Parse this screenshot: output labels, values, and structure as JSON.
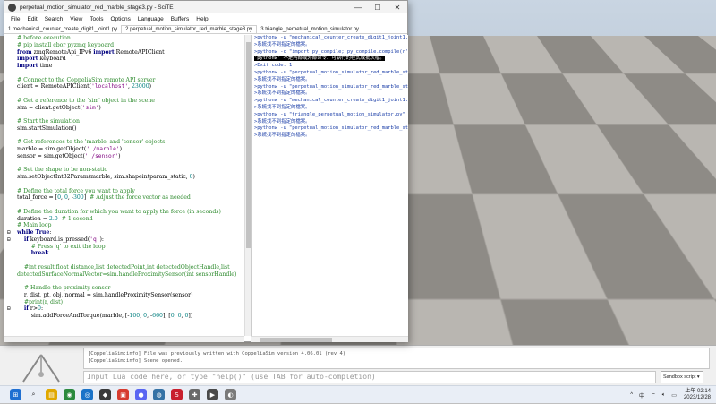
{
  "window": {
    "title": "perpetual_motion_simulator_red_marble_stage3.py - SciTE",
    "controls": {
      "minimize": "—",
      "maximize": "☐",
      "close": "✕"
    }
  },
  "menu": [
    "File",
    "Edit",
    "Search",
    "View",
    "Tools",
    "Options",
    "Language",
    "Buffers",
    "Help"
  ],
  "tabs": [
    {
      "label": "1 mechanical_counter_create_digit1_joint1.py",
      "active": false
    },
    {
      "label": "2 perpetual_motion_simulator_red_marble_stage3.py",
      "active": true
    },
    {
      "label": "3 triangle_perpetual_motion_simulator.py",
      "active": false
    }
  ],
  "code_lines": [
    {
      "text": "# before execution",
      "cls": "cm",
      "fold": ""
    },
    {
      "text": "# pip install cbor pyzmq keyboard",
      "cls": "cm",
      "fold": ""
    },
    {
      "text": "from zmqRemoteApi_IPv6 import RemoteAPIClient",
      "cls": "kwline",
      "fold": ""
    },
    {
      "text": "import keyboard",
      "cls": "kwline",
      "fold": ""
    },
    {
      "text": "import time",
      "cls": "kwline",
      "fold": ""
    },
    {
      "text": "",
      "cls": "tx",
      "fold": ""
    },
    {
      "text": "# Connect to the CoppeliaSim remote API server",
      "cls": "cm",
      "fold": ""
    },
    {
      "text": "client = RemoteAPIClient('localhost', 23000)",
      "cls": "tx",
      "fold": ""
    },
    {
      "text": "",
      "cls": "tx",
      "fold": ""
    },
    {
      "text": "# Get a reference to the 'sim' object in the scene",
      "cls": "cm",
      "fold": ""
    },
    {
      "text": "sim = client.getObject('sim')",
      "cls": "tx",
      "fold": ""
    },
    {
      "text": "",
      "cls": "tx",
      "fold": ""
    },
    {
      "text": "# Start the simulation",
      "cls": "cm",
      "fold": ""
    },
    {
      "text": "sim.startSimulation()",
      "cls": "tx",
      "fold": ""
    },
    {
      "text": "",
      "cls": "tx",
      "fold": ""
    },
    {
      "text": "# Get references to the 'marble' and 'sensor' objects",
      "cls": "cm",
      "fold": ""
    },
    {
      "text": "marble = sim.getObject('./marble')",
      "cls": "tx",
      "fold": ""
    },
    {
      "text": "sensor = sim.getObject('./sensor')",
      "cls": "tx",
      "fold": ""
    },
    {
      "text": "",
      "cls": "tx",
      "fold": ""
    },
    {
      "text": "# Set the shape to be non-static",
      "cls": "cm",
      "fold": ""
    },
    {
      "text": "sim.setObjectInt32Param(marble, sim.shapeintparam_static, 0)",
      "cls": "tx",
      "fold": ""
    },
    {
      "text": "",
      "cls": "tx",
      "fold": ""
    },
    {
      "text": "# Define the total force you want to apply",
      "cls": "cm",
      "fold": ""
    },
    {
      "text": "total_force = [0, 0, -300]  # Adjust the force vector as needed",
      "cls": "tx",
      "fold": ""
    },
    {
      "text": "",
      "cls": "tx",
      "fold": ""
    },
    {
      "text": "# Define the duration for which you want to apply the force (in seconds)",
      "cls": "cm",
      "fold": ""
    },
    {
      "text": "duration = 2.0  # 1 second",
      "cls": "tx",
      "fold": ""
    },
    {
      "text": "# Main loop",
      "cls": "cm",
      "fold": ""
    },
    {
      "text": "while True:",
      "cls": "kwline",
      "fold": "⊟"
    },
    {
      "text": "    if keyboard.is_pressed('q'):",
      "cls": "tx",
      "fold": "⊟"
    },
    {
      "text": "        # Press 'q' to exit the loop",
      "cls": "cm",
      "fold": ""
    },
    {
      "text": "        break",
      "cls": "kwline",
      "fold": ""
    },
    {
      "text": "",
      "cls": "tx",
      "fold": ""
    },
    {
      "text": "    #int result,float distance,list detectedPoint,int detectedObjectHandle,list",
      "cls": "cm",
      "fold": ""
    },
    {
      "text": "detectedSurfaceNormalVector=sim.handleProximitySensor(int sensorHandle)",
      "cls": "cm",
      "fold": ""
    },
    {
      "text": "",
      "cls": "tx",
      "fold": ""
    },
    {
      "text": "    # Handle the proximity sensor",
      "cls": "cm",
      "fold": ""
    },
    {
      "text": "    r, dist, pt, obj, normal = sim.handleProximitySensor(sensor)",
      "cls": "tx",
      "fold": ""
    },
    {
      "text": "    #print(r, dist)",
      "cls": "cm",
      "fold": ""
    },
    {
      "text": "    if r>0:",
      "cls": "tx",
      "fold": "⊟"
    },
    {
      "text": "        sim.addForceAndTorque(marble, [-100, 0, -660], [0, 0, 0])",
      "cls": "tx",
      "fold": ""
    }
  ],
  "output_lines": [
    ">pythonw -u \"mechanical_counter_create_digit1_joint1.py\"",
    ">系統找不到指定的檔案。",
    ">pythonw -c \"import py_compile; py_compile.compile(r'E:\\CAD",
    "'pythonw' 不是內部或外部命令、可執行的程式或批次檔。",
    ">Exit code: 1",
    ">pythonw -u \"perpetual_motion_simulator_red_marble_stage3",
    ">系統找不到指定的檔案。",
    ">pythonw -u \"perpetual_motion_simulator_red_marble_stage3",
    ">系統找不到指定的檔案。",
    ">pythonw -u \"mechanical_counter_create_digit1_joint1.py\"",
    ">系統找不到指定的檔案。",
    ">pythonw -u \"triangle_perpetual_motion_simulator.py\"",
    ">系統找不到指定的檔案。",
    ">pythonw -u \"perpetual_motion_simulator_red_marble_stage3",
    ">系統找不到指定的檔案。"
  ],
  "console": {
    "log_line1": "[CoppeliaSim:info]  File was previously written with CoppeliaSim version 4.06.01 (rev 4)",
    "log_line2": "[CoppeliaSim:info]  Scene opened.",
    "input_placeholder": "Input Lua code here, or type \"help()\" (use TAB for auto-completion)",
    "sandbox_label": "Sandbox script"
  },
  "taskbar": {
    "icons": [
      "windows-icon",
      "search-icon",
      "file-explorer-icon",
      "chrome-icon",
      "edge-icon",
      "coppeliasim-icon",
      "app-icon",
      "discord-icon",
      "python-icon",
      "solidworks-icon",
      "app-icon-2",
      "scite-icon",
      "app-icon-3"
    ],
    "tray_caret": "^",
    "ime": "中",
    "clock_time": "上午 02:14",
    "clock_date": "2023/12/28"
  },
  "colors": {
    "comment": "#2e8b2e",
    "keyword": "#00007f",
    "string": "#7f007f",
    "output_text": "#1c3fa8",
    "force_vector": "#d41d6f"
  }
}
